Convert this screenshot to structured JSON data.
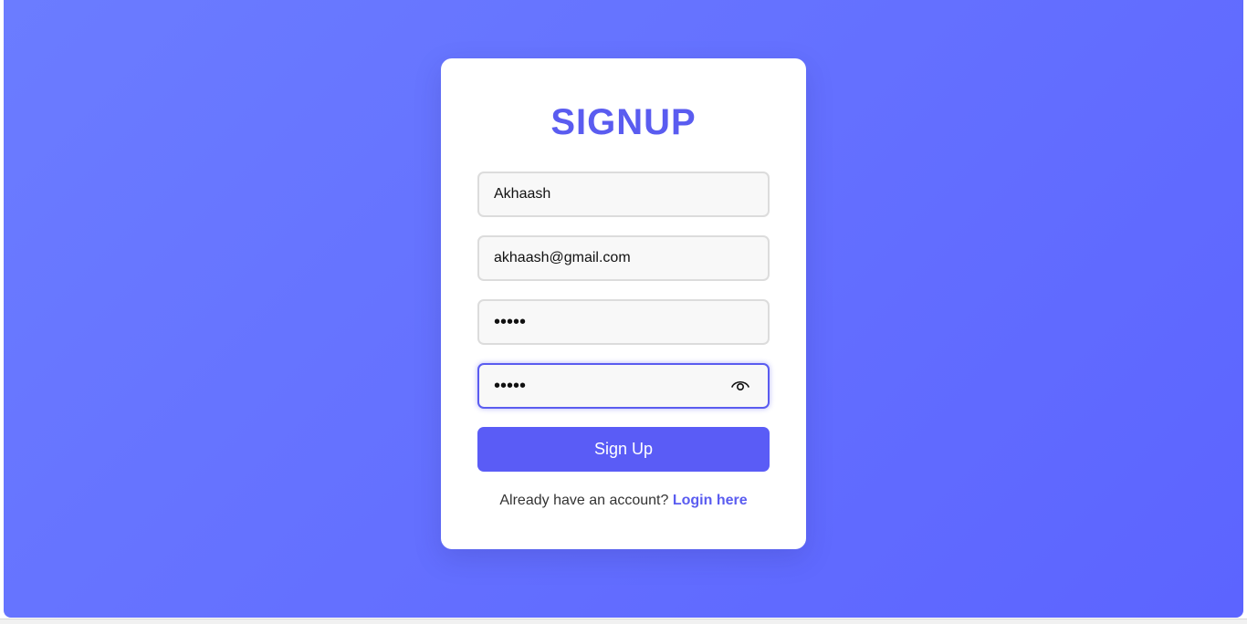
{
  "form": {
    "title": "SIGNUP",
    "username_value": "Akhaash",
    "email_value": "akhaash@gmail.com",
    "password_value": "•••••",
    "confirm_password_value": "•••••",
    "submit_label": "Sign Up",
    "footer_text": "Already have an account?",
    "login_link_label": "Login here"
  },
  "colors": {
    "accent": "#5a5cf0",
    "background_gradient_start": "#6b7cff",
    "background_gradient_end": "#5c64ff"
  },
  "icons": {
    "password_toggle": "eye-icon"
  }
}
